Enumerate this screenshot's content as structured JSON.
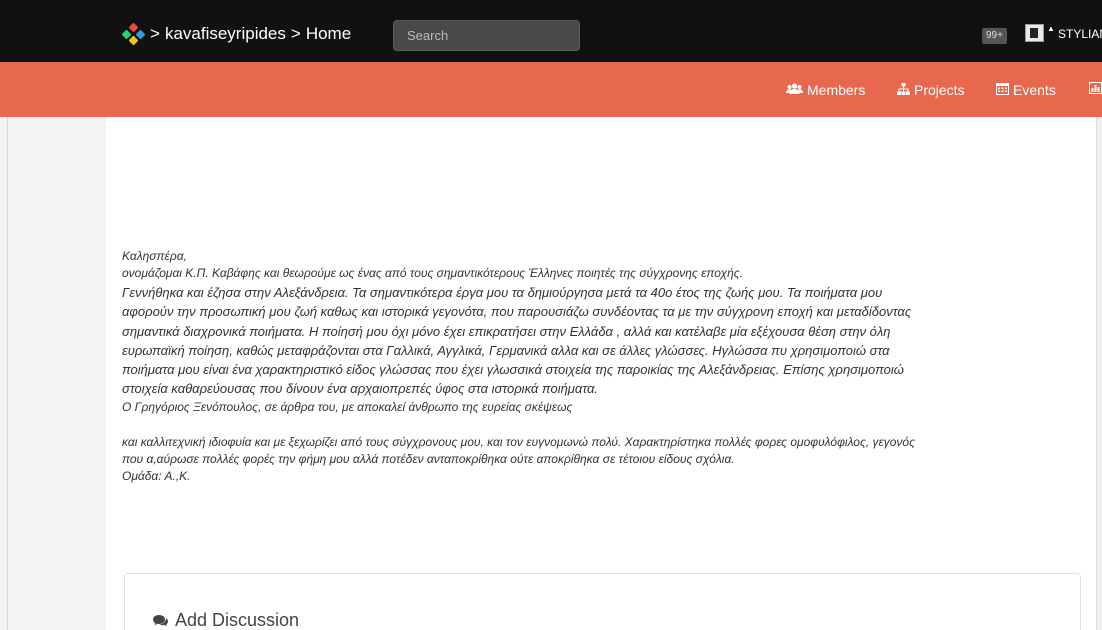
{
  "topbar": {
    "breadcrumb_sep": ">",
    "community": "kavafiseyripides",
    "page": "Home",
    "search_placeholder": "Search",
    "notifications": "99+",
    "user_name": "STYLIAN",
    "logo_colors": [
      "#e74c3c",
      "#2ecc71",
      "#3498db",
      "#f1c40f"
    ]
  },
  "nav": {
    "members": "Members",
    "projects": "Projects",
    "events": "Events"
  },
  "post": {
    "greeting": "Καλησπέρα,",
    "intro": "ονομάζομαι Κ.Π. Καβάφης και θεωρούμε ως ένας από τους σημαντικότερους Έλληνες ποιητές της σύγχρονης εποχής.",
    "body_lines": [
      "Γεννήθηκα και έζησα στην Αλεξάνδρεια. Τα σημαντικότερα έργα μου τα δημιούργησα μετά τα 40ο έτος της ζωής μου. Τα ποιήματα μου",
      "αφορούν την προσωπική μου ζωή καθως και ιστορικά γεγονότα, που παρουσιάζω συνδέοντας τα με την σύγχρονη εποχή και μεταδίδοντας",
      "σημαντικά διαχρονικά ποιήματα. Η ποίησή μου όχι μόνο έχει επικρατήσει στην Ελλάδα , αλλά και κατέλαβε μία εξέχουσα θέση στην όλη",
      "ευρωπαϊκή ποίηση, καθώς μεταφράζονται στα Γαλλικά, Αγγλικά, Γερμανικά αλλα και σε άλλες γλώσσες. Ηγλώσσα πυ χρησιμοποιώ στα",
      "ποιήματα μου είναι ένα χαρακτηριστικό είδος γλώσσας που έχει γλωσσικά στοιχεία της παροικίας της Αλεξάνδρειας. Επίσης χρησιμοποιώ",
      "στοιχεία καθαρεύουσας που δίνουν ένα αρχαιοπρεπές ύφος στα ιστορικά ποιήματα."
    ],
    "quote_line": "Ο Γρηγόριος Ξενόπουλος, σε άρθρα του, με αποκαλεί άνθρωπο της ευρείας σκέψεως",
    "closing_lines": [
      "και καλλιτεχνική ιδιοφυία και με ξεχωρίζει από τους σύγχρονους μου, και τον ευγνομωνώ πολύ. Χαρακτηρίστηκα πολλές φορες ομοφυλόφιλος, γεγονός",
      "που α,αύρωσε πολλές φορές την φήμη μου αλλά ποτέδεν ανταποκρίθηκα ούτε αποκρίθηκα σε τέτοιου είδους σχόλια."
    ],
    "team": "Ομάδα: Α.,Κ."
  },
  "discussion": {
    "title": "Add Discussion"
  },
  "colors": {
    "topbar": "#111111",
    "nav": "#e7684e"
  }
}
